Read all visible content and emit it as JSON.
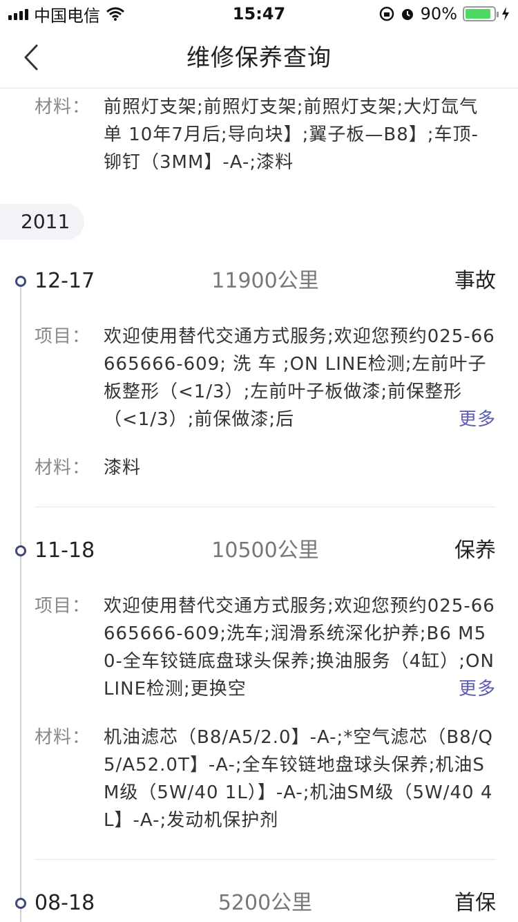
{
  "status_bar": {
    "carrier": "中国电信",
    "time": "15:47",
    "battery_percent": "90%",
    "battery_level": 0.9
  },
  "nav": {
    "title": "维修保养查询",
    "back_icon": "chevron-left-icon"
  },
  "prev_record": {
    "materials_label": "材料：",
    "materials": "前照灯支架;前照灯支架;前照灯支架;大灯氙气 单 10年7月后;导向块】;翼子板—B8】;车顶-铆钉（3MM】-A-;漆料"
  },
  "year": "2011",
  "more_label": "更多",
  "records": [
    {
      "date": "12-17",
      "mileage": "11900公里",
      "type": "事故",
      "items_label": "项目：",
      "items": "欢迎使用替代交通方式服务;欢迎您预约025-66665666-609; 洗 车 ;ON LINE检测;左前叶子板整形（<1/3）;左前叶子板做漆;前保整形（<1/3）;前保做漆;后",
      "materials_label": "材料：",
      "materials": "漆料"
    },
    {
      "date": "11-18",
      "mileage": "10500公里",
      "type": "保养",
      "items_label": "项目：",
      "items": "欢迎使用替代交通方式服务;欢迎您预约025-66665666-609;洗车;润滑系统深化护养;B6 M50-全车铰链底盘球头保养;换油服务（4缸）;ON LINE检测;更换空",
      "materials_label": "材料：",
      "materials": "机油滤芯（B8/A5/2.0】-A-;*空气滤芯（B8/Q5/A52.0T】-A-;全车铰链地盘球头保养;机油SM级（5W/40 1L）】-A-;机油SM级（5W/40 4L】-A-;发动机保护剂"
    },
    {
      "date": "08-18",
      "mileage": "5200公里",
      "type": "首保"
    }
  ],
  "colors": {
    "accent": "#5b5bb8",
    "timeline_dot": "#3e4a78",
    "battery_green": "#4cd964"
  }
}
